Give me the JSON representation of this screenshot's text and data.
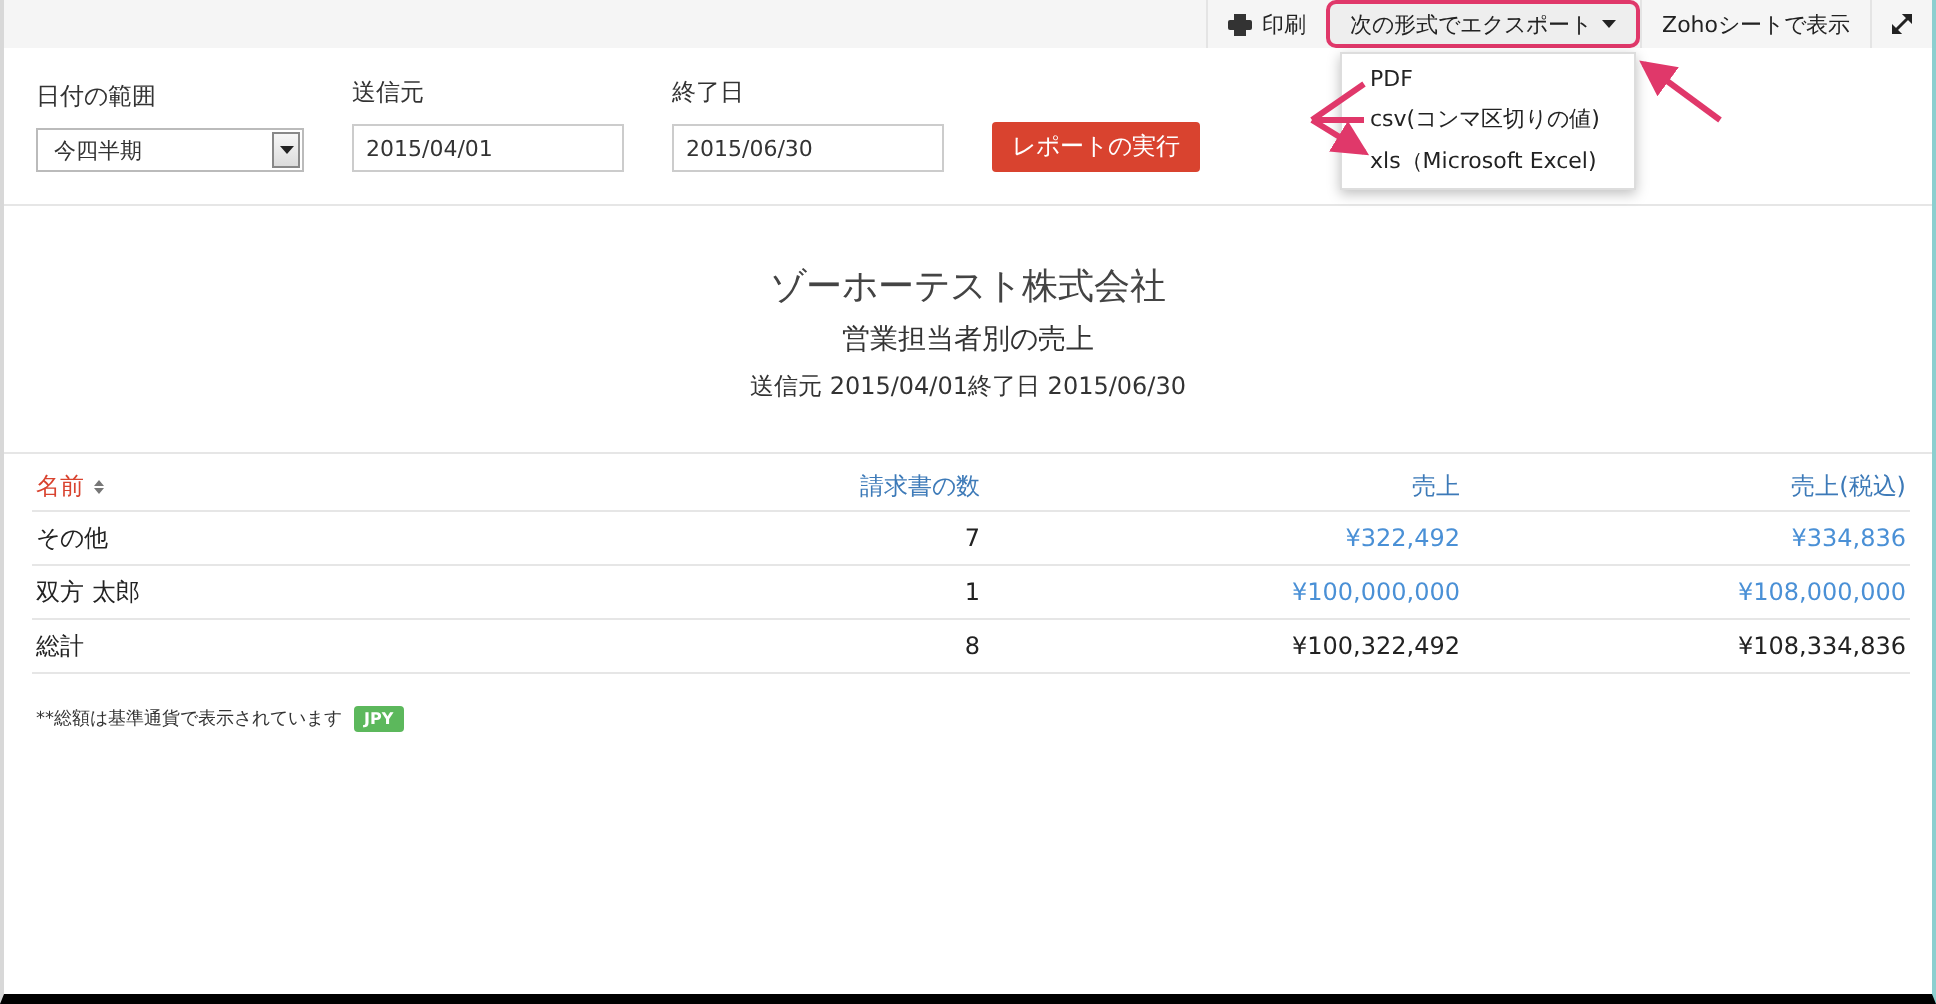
{
  "toolbar": {
    "buttons": [
      {
        "kind": "print",
        "label": "印刷",
        "highlighted": false
      },
      {
        "kind": "export",
        "label": "次の形式でエクスポート",
        "highlighted": true
      },
      {
        "kind": "sheet",
        "label": "Zohoシートで表示",
        "highlighted": false
      },
      {
        "kind": "expand",
        "highlighted": false
      }
    ]
  },
  "export_menu": {
    "items": [
      "PDF",
      "csv(コンマ区切りの値)",
      "xls（Microsoft Excel)"
    ]
  },
  "filters": [
    {
      "kind": "select",
      "label": "日付の範囲",
      "value": "今四半期"
    },
    {
      "kind": "text",
      "label": "送信元",
      "value": "2015/04/01"
    },
    {
      "kind": "text",
      "label": "終了日",
      "value": "2015/06/30"
    }
  ],
  "run_button": "レポートの実行",
  "report": {
    "company": "ゾーホーテスト株式会社",
    "title": "営業担当者別の売上",
    "period": "送信元 2015/04/01終了日 2015/06/30"
  },
  "table": {
    "columns": [
      {
        "label": "名前",
        "sorted": true
      },
      {
        "label": "請求書の数",
        "sorted": false
      },
      {
        "label": "売上",
        "sorted": false
      },
      {
        "label": "売上(税込)",
        "sorted": false
      }
    ],
    "rows": [
      {
        "cells": [
          {
            "text": "その他",
            "link": false
          },
          {
            "text": "7",
            "link": false
          },
          {
            "text": "¥322,492",
            "link": true
          },
          {
            "text": "¥334,836",
            "link": true
          }
        ]
      },
      {
        "cells": [
          {
            "text": "双方 太郎",
            "link": false
          },
          {
            "text": "1",
            "link": false
          },
          {
            "text": "¥100,000,000",
            "link": true
          },
          {
            "text": "¥108,000,000",
            "link": true
          }
        ]
      },
      {
        "cells": [
          {
            "text": "総計",
            "link": false
          },
          {
            "text": "8",
            "link": false
          },
          {
            "text": "¥100,322,492",
            "link": false
          },
          {
            "text": "¥108,334,836",
            "link": false
          }
        ]
      }
    ]
  },
  "footnote": "**総額は基準通貨で表示されています",
  "currency_badge": "JPY"
}
